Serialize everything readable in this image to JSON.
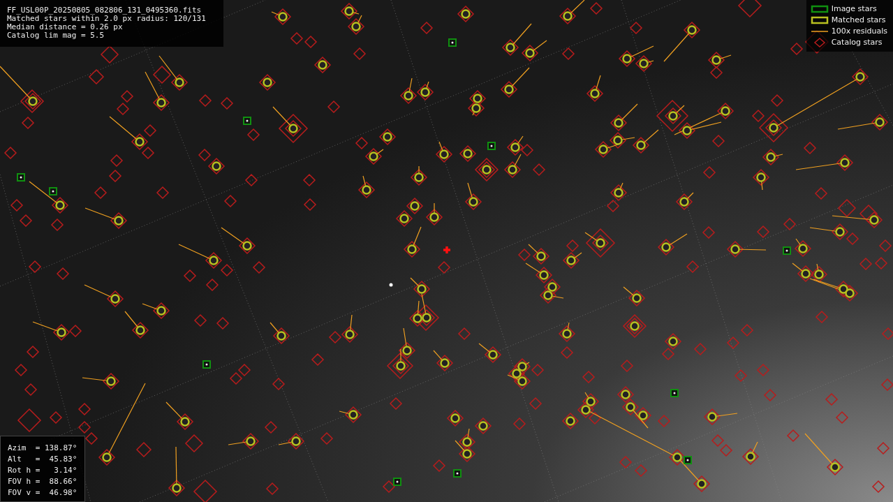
{
  "info": {
    "lines": [
      "FF_USL00P_20250805_082806_131_0495360.fits",
      "Matched stars within 2.0 px radius: 120/131",
      "Median distance = 0.26 px",
      "Catalog lim mag = 5.5"
    ]
  },
  "legend": [
    {
      "kind": "image",
      "label": "Image stars"
    },
    {
      "kind": "matched",
      "label": "Matched stars"
    },
    {
      "kind": "residual",
      "label": "100x residuals"
    },
    {
      "kind": "catalog",
      "label": "Catalog stars"
    }
  ],
  "orientation": {
    "lines": [
      "Azim  = 138.87°",
      "Alt   =  45.83°",
      "Rot h =   3.14°",
      "FOV h =  88.66°",
      "FOV v =  46.98°"
    ]
  }
}
